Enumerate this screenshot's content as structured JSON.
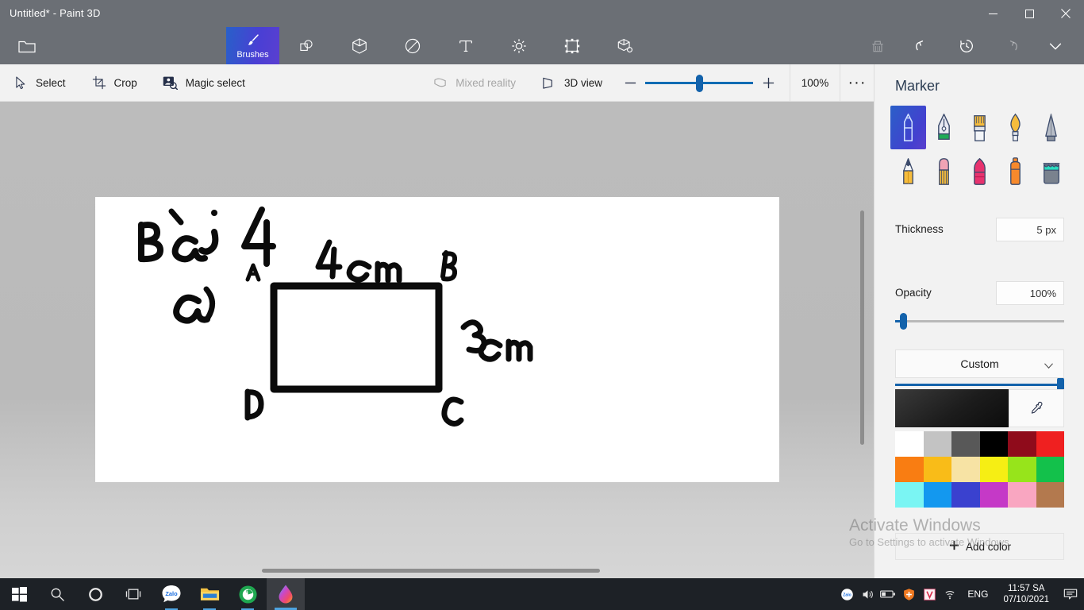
{
  "window": {
    "title": "Untitled* - Paint 3D",
    "minimize_label": "Minimize",
    "maximize_label": "Restore",
    "close_label": "Close"
  },
  "ribbon": {
    "menu_label": "Menu",
    "items": [
      {
        "label": "Brushes",
        "icon": "brush-icon",
        "active": true
      },
      {
        "label": "2D shapes",
        "icon": "shapes-2d-icon",
        "active": false
      },
      {
        "label": "3D shapes",
        "icon": "shapes-3d-icon",
        "active": false
      },
      {
        "label": "Stickers",
        "icon": "stickers-icon",
        "active": false
      },
      {
        "label": "Text",
        "icon": "text-icon",
        "active": false
      },
      {
        "label": "Effects",
        "icon": "effects-icon",
        "active": false
      },
      {
        "label": "Canvas",
        "icon": "canvas-icon",
        "active": false
      },
      {
        "label": "3D library",
        "icon": "library-3d-icon",
        "active": false
      }
    ],
    "right": [
      {
        "label": "Share",
        "icon": "share-icon",
        "dim": true
      },
      {
        "label": "Undo",
        "icon": "undo-icon",
        "dim": false
      },
      {
        "label": "History",
        "icon": "history-icon",
        "dim": false
      },
      {
        "label": "Redo",
        "icon": "redo-icon",
        "dim": true
      },
      {
        "label": "Expand menu",
        "icon": "chevron-down-icon",
        "dim": false
      }
    ]
  },
  "toolbar": {
    "select_label": "Select",
    "crop_label": "Crop",
    "magic_select_label": "Magic select",
    "mixed_reality_label": "Mixed reality",
    "view_3d_label": "3D view",
    "zoom_out_label": "Zoom out",
    "zoom_in_label": "Zoom in",
    "zoom_value": "100%",
    "more_label": "More options"
  },
  "panel": {
    "title": "Marker",
    "brushes": [
      {
        "name": "marker",
        "selected": true
      },
      {
        "name": "calligraphy-pen",
        "selected": false
      },
      {
        "name": "oil-brush",
        "selected": false
      },
      {
        "name": "watercolor",
        "selected": false
      },
      {
        "name": "pixel-pen",
        "selected": false
      },
      {
        "name": "pencil",
        "selected": false
      },
      {
        "name": "eraser",
        "selected": false
      },
      {
        "name": "crayon",
        "selected": false
      },
      {
        "name": "spray-can",
        "selected": false
      },
      {
        "name": "fill",
        "selected": false
      }
    ],
    "thickness": {
      "label": "Thickness",
      "value": "5 px",
      "percent": 5
    },
    "opacity": {
      "label": "Opacity",
      "value": "100%",
      "percent": 100
    },
    "color_group": "Custom",
    "current_color": "#1c1c1c",
    "eyedropper_label": "Color picker",
    "palette": [
      "#ffffff",
      "#c3c3c3",
      "#585858",
      "#000000",
      "#8f0b1b",
      "#ef2020",
      "#f97d12",
      "#f9bc18",
      "#f7e3a4",
      "#f6ee14",
      "#97e41b",
      "#13c14b",
      "#7af5f3",
      "#1398ef",
      "#3a41cf",
      "#c539c7",
      "#f9a6c1",
      "#b37murky"
    ],
    "palette_colors": [
      "#ffffff",
      "#c3c3c3",
      "#585858",
      "#000000",
      "#8f0b1b",
      "#ef2020",
      "#f97d12",
      "#f9bc18",
      "#f7e3a4",
      "#f6ee14",
      "#97e41b",
      "#13c14b",
      "#7af5f3",
      "#1398ef",
      "#3a41cf",
      "#c539c7",
      "#f9a6c1",
      "#b3794e"
    ],
    "add_color_label": "Add color"
  },
  "canvas": {
    "drawing_note": "Handwritten geometry exercise on white canvas",
    "texts": {
      "heading": "Bài 4",
      "part": "a)",
      "top_length": "4 cm",
      "side_length": "3 cm",
      "vertex_a": "A",
      "vertex_b": "B",
      "vertex_c": "C",
      "vertex_d": "D"
    }
  },
  "watermark": {
    "line1": "Activate Windows",
    "line2": "Go to Settings to activate Windows."
  },
  "taskbar": {
    "items": [
      {
        "name": "start-button",
        "label": "Start"
      },
      {
        "name": "search-button",
        "label": "Search"
      },
      {
        "name": "cortana-button",
        "label": "Cortana"
      },
      {
        "name": "task-view-button",
        "label": "Task View"
      },
      {
        "name": "zalo-app",
        "label": "Zalo"
      },
      {
        "name": "file-explorer-app",
        "label": "File Explorer"
      },
      {
        "name": "browser-app",
        "label": "Browser"
      },
      {
        "name": "paint3d-app",
        "label": "Paint 3D"
      }
    ],
    "tray": {
      "zalo_label": "Zalo",
      "volume_label": "Speakers",
      "battery_label": "Battery",
      "security_label": "Security",
      "unikey_label": "Unikey",
      "network_label": "Network",
      "language": "ENG",
      "time": "11:57 SA",
      "date": "07/10/2021",
      "notifications_label": "Notifications"
    }
  }
}
